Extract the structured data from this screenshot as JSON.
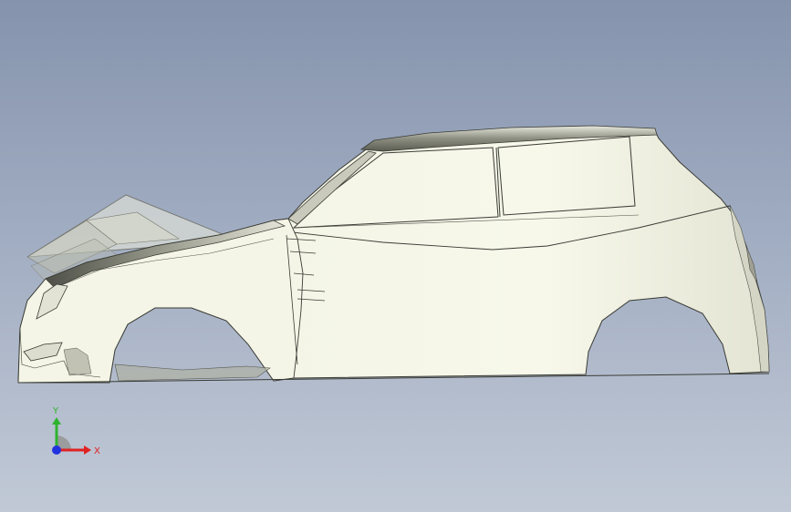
{
  "viewport": {
    "background_top": "#8593ad",
    "background_bottom": "#c1c9d6",
    "body_color": "#f7f8ea",
    "shade_color": "#6e7062",
    "edge_color": "#3a3b35"
  },
  "triad": {
    "y_label": "Y",
    "x_label": "X",
    "y_color": "#2fb32f",
    "x_color": "#e02222",
    "z_color": "#2233dd"
  }
}
